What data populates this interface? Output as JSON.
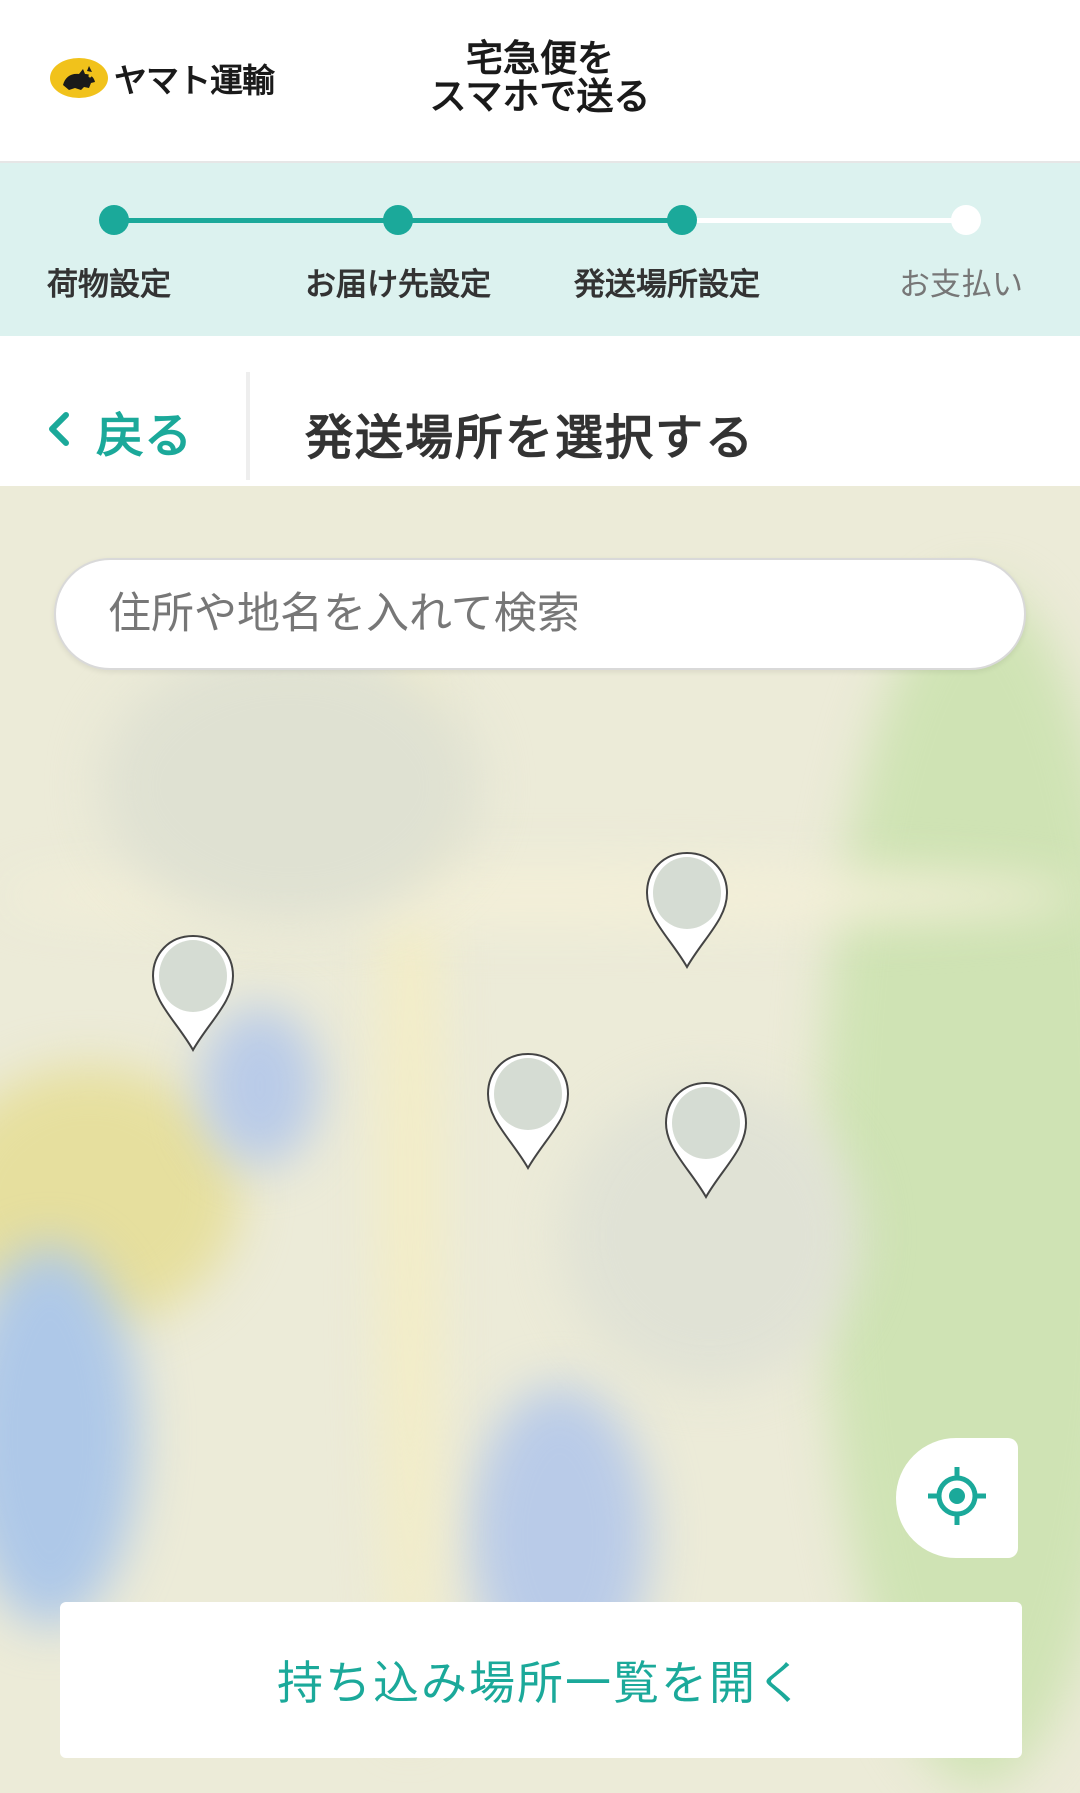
{
  "header": {
    "logo_text": "ヤマト運輸",
    "logo_icon": "black-cat-icon",
    "title_line1": "宅急便を",
    "title_line2": "スマホで送る"
  },
  "stepper": {
    "steps": [
      {
        "label": "荷物設定",
        "state": "done"
      },
      {
        "label": "お届け先設定",
        "state": "done"
      },
      {
        "label": "発送場所設定",
        "state": "current"
      },
      {
        "label": "お支払い",
        "state": "pending"
      }
    ]
  },
  "titlebar": {
    "back_label": "戻る",
    "back_icon": "chevron-left-icon",
    "title": "発送場所を選択する"
  },
  "map": {
    "search_placeholder": "住所や地名を入れて検索",
    "pins": [
      "location-pin",
      "location-pin",
      "location-pin",
      "location-pin"
    ],
    "locate_icon": "crosshair-locate-icon",
    "open_list_label": "持ち込み場所一覧を開く"
  },
  "colors": {
    "accent": "#1ba99a",
    "stepper_bg": "#dcf2ef",
    "logo_yellow": "#f1c21b"
  }
}
